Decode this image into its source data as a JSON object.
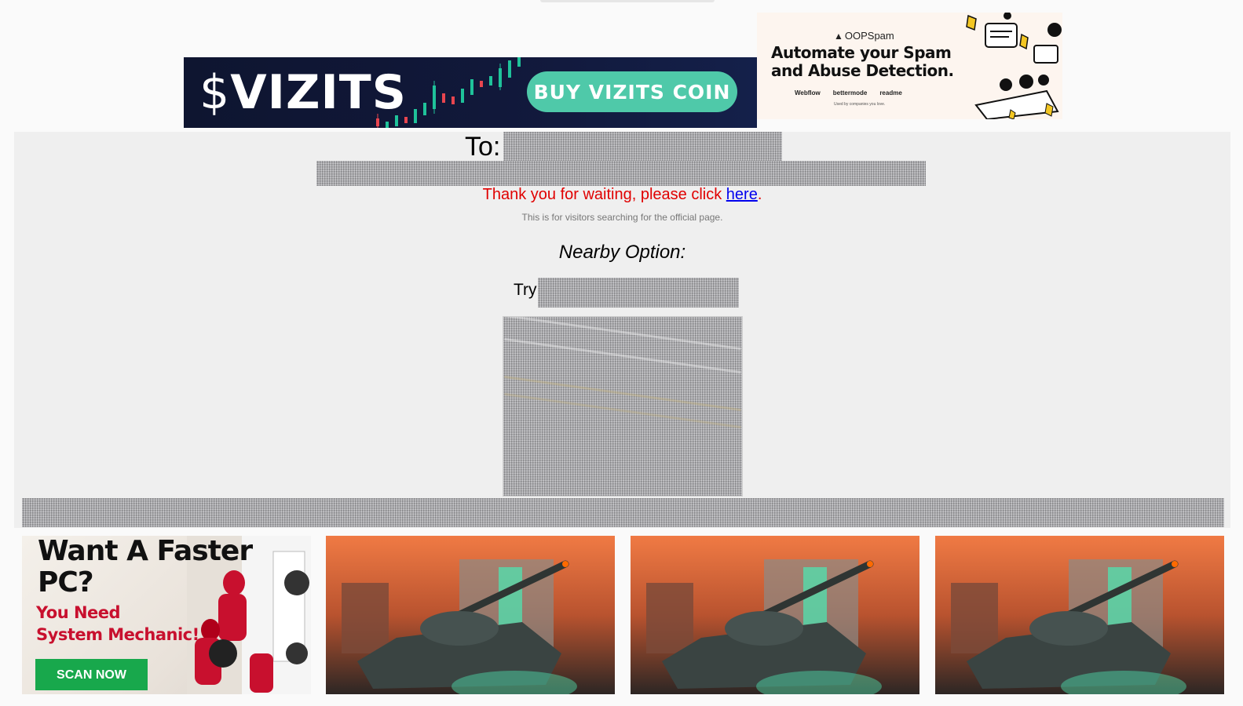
{
  "banners": {
    "vizits": {
      "logo_dollar": "$",
      "logo_text": "VIZITS",
      "button_label": "BUY VIZITS COIN",
      "colors": {
        "background": "#0e1530",
        "button": "#4fc9a9",
        "candle_up": "#1fc29a",
        "candle_down": "#e8454f"
      }
    },
    "oopspam": {
      "brand": "OOPSpam",
      "headline": "Automate your Spam and Abuse Detection.",
      "logos": [
        "Webflow",
        "bettermode",
        "readme"
      ],
      "used_by": "Used by companies you love."
    }
  },
  "main": {
    "to_label": "To:",
    "thanks_text": "Thank you for waiting, please click ",
    "thanks_link": "here",
    "thanks_period": ".",
    "subnote": "This is for visitors searching for the official page.",
    "nearby_heading": "Nearby Option:",
    "try_label": "Try",
    "colors": {
      "thanks": "#e00000",
      "link": "#0000ee",
      "panel": "#efefef"
    }
  },
  "ads": {
    "mechanic": {
      "headline_line1": "Want A Faster",
      "headline_line2": "PC?",
      "sub_line1": "You Need",
      "sub_line2": "System Mechanic!",
      "button_label": "SCAN NOW",
      "colors": {
        "sub": "#c8102e",
        "button": "#18a84c"
      }
    },
    "tank_count": 3
  }
}
